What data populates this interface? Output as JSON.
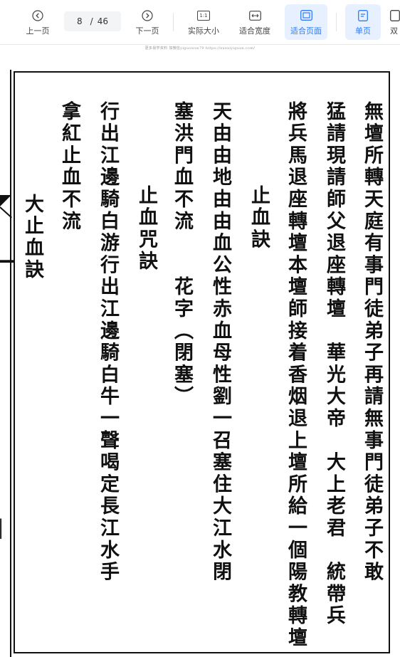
{
  "toolbar": {
    "prev_label": "上一页",
    "current_page": "8",
    "separator": "/",
    "total_pages": "46",
    "next_label": "下一页",
    "actual_size_label": "实际大小",
    "actual_size_icon_text": "1:1",
    "fit_width_label": "适合宽度",
    "fit_page_label": "适合页面",
    "single_page_label": "单页",
    "double_page_label_partial": "双"
  },
  "watermark": "更多易学资料 加微信yiguowan79  https://xuexiyiguan.com/",
  "document": {
    "columns": [
      "無壇所轉天庭有事門徒弟子再請無事門徒弟子不敢",
      "猛請現請師父退座轉壇　華光大帝　大上老君　統帶兵",
      "將兵馬退座轉壇本壇師接着香烟退上壇所給一個陽教轉壇",
      "止血訣",
      "天由由地由由血公性赤血母性劉一召塞住大江水閉",
      "塞洪門血不流　　花字（閉塞）",
      "止血咒訣",
      "行出江邊騎白游行出江邊騎白牛一聲喝定長江水手",
      "拿紅止血不流",
      "大止血訣"
    ]
  }
}
